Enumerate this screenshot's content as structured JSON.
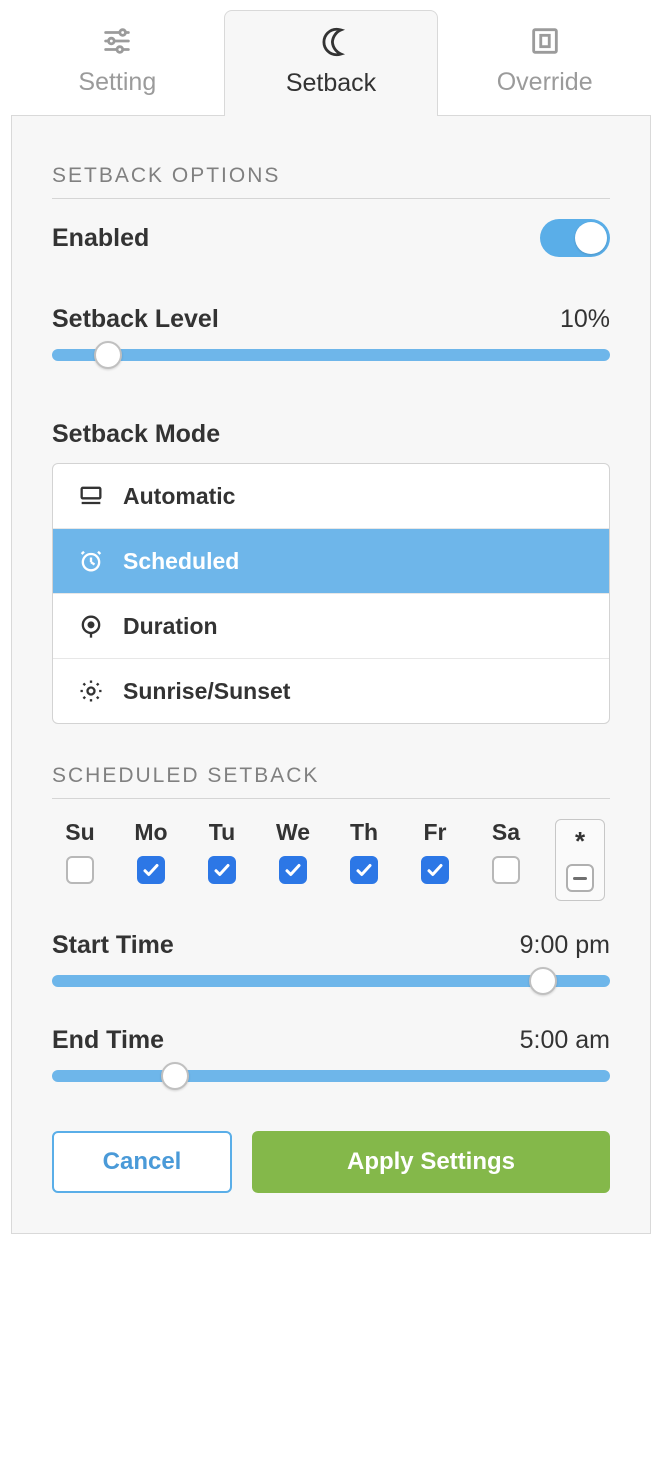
{
  "tabs": {
    "setting_label": "Setting",
    "setback_label": "Setback",
    "override_label": "Override",
    "active_index": 1
  },
  "setback": {
    "options_header": "SETBACK OPTIONS",
    "enabled_label": "Enabled",
    "enabled_value": true,
    "level_label": "Setback Level",
    "level_value": "10%",
    "level_slider_pct": 10,
    "mode_label": "Setback Mode",
    "modes": [
      {
        "label": "Automatic",
        "icon": "automatic-icon",
        "selected": false
      },
      {
        "label": "Scheduled",
        "icon": "scheduled-icon",
        "selected": true
      },
      {
        "label": "Duration",
        "icon": "duration-icon",
        "selected": false
      },
      {
        "label": "Sunrise/Sunset",
        "icon": "sunrise-icon",
        "selected": false
      }
    ]
  },
  "scheduled": {
    "header": "SCHEDULED SETBACK",
    "days": [
      {
        "short": "Su",
        "checked": false
      },
      {
        "short": "Mo",
        "checked": true
      },
      {
        "short": "Tu",
        "checked": true
      },
      {
        "short": "We",
        "checked": true
      },
      {
        "short": "Th",
        "checked": true
      },
      {
        "short": "Fr",
        "checked": true
      },
      {
        "short": "Sa",
        "checked": false
      }
    ],
    "all_symbol": "*",
    "start_label": "Start Time",
    "start_value": "9:00 pm",
    "start_slider_pct": 88,
    "end_label": "End Time",
    "end_value": "5:00 am",
    "end_slider_pct": 22
  },
  "buttons": {
    "cancel": "Cancel",
    "apply": "Apply Settings"
  }
}
